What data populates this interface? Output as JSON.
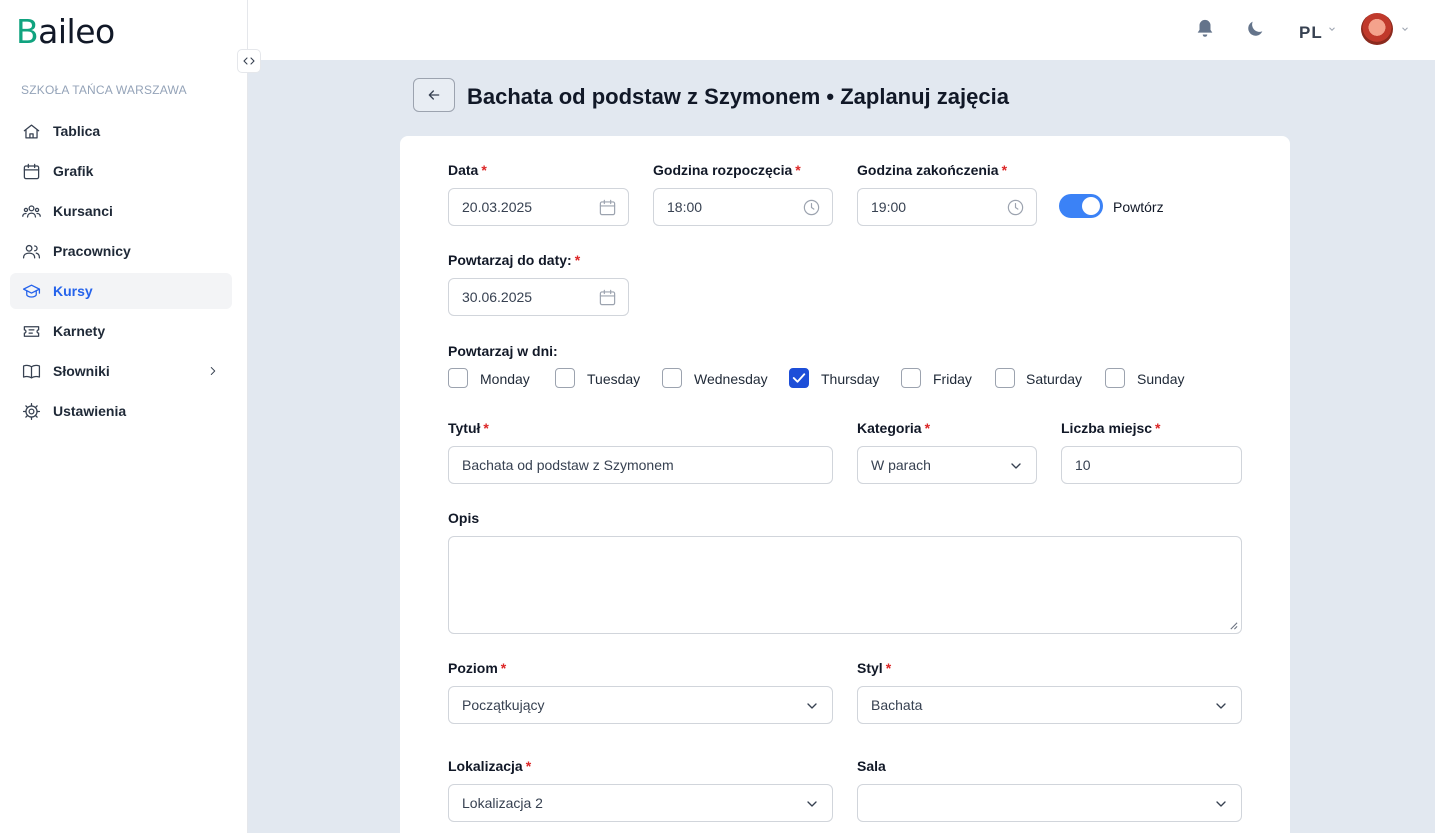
{
  "app": {
    "logo_b": "B",
    "logo_rest": "aileo"
  },
  "sidebar": {
    "org": "SZKOŁA TAŃCA WARSZAWA",
    "items": [
      {
        "label": "Tablica",
        "icon": "home-icon"
      },
      {
        "label": "Grafik",
        "icon": "calendar-icon"
      },
      {
        "label": "Kursanci",
        "icon": "users-group-icon"
      },
      {
        "label": "Pracownicy",
        "icon": "users-icon"
      },
      {
        "label": "Kursy",
        "icon": "graduation-cap-icon",
        "active": true
      },
      {
        "label": "Karnety",
        "icon": "ticket-icon"
      },
      {
        "label": "Słowniki",
        "icon": "book-icon",
        "has_children": true
      },
      {
        "label": "Ustawienia",
        "icon": "gear-icon"
      }
    ]
  },
  "topbar": {
    "lang": "PL"
  },
  "header": {
    "title": "Bachata od podstaw z Szymonem • Zaplanuj zajęcia"
  },
  "form": {
    "date": {
      "label": "Data",
      "value": "20.03.2025"
    },
    "start": {
      "label": "Godzina rozpoczęcia",
      "value": "18:00"
    },
    "end": {
      "label": "Godzina zakończenia",
      "value": "19:00"
    },
    "repeat": {
      "label": "Powtórz",
      "on": true
    },
    "repeat_until": {
      "label": "Powtarzaj do daty:",
      "value": "30.06.2025"
    },
    "repeat_days": {
      "label": "Powtarzaj w dni:",
      "days": [
        {
          "label": "Monday",
          "checked": false
        },
        {
          "label": "Tuesday",
          "checked": false
        },
        {
          "label": "Wednesday",
          "checked": false
        },
        {
          "label": "Thursday",
          "checked": true
        },
        {
          "label": "Friday",
          "checked": false
        },
        {
          "label": "Saturday",
          "checked": false
        },
        {
          "label": "Sunday",
          "checked": false
        }
      ]
    },
    "title": {
      "label": "Tytuł",
      "value": "Bachata od podstaw z Szymonem"
    },
    "category": {
      "label": "Kategoria",
      "value": "W parach"
    },
    "seats": {
      "label": "Liczba miejsc",
      "value": "10"
    },
    "description": {
      "label": "Opis",
      "value": ""
    },
    "level": {
      "label": "Poziom",
      "value": "Początkujący"
    },
    "style": {
      "label": "Styl",
      "value": "Bachata"
    },
    "location": {
      "label": "Lokalizacja",
      "value": "Lokalizacja 2"
    },
    "room": {
      "label": "Sala",
      "value": ""
    }
  },
  "colors": {
    "accent": "#2563eb",
    "toggle": "#3b82f6",
    "required": "#dc2626",
    "logo_b": "#10a37f"
  }
}
